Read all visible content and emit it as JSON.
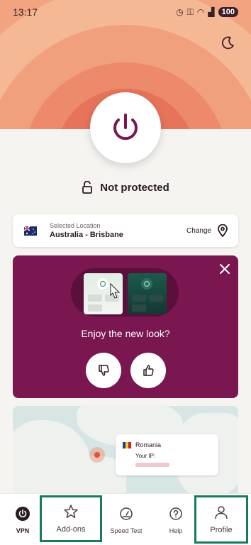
{
  "status_bar": {
    "time": "13:17",
    "battery": "100"
  },
  "status": {
    "label": "Not protected"
  },
  "location": {
    "caption": "Selected Location",
    "name": "Australia - Brisbane",
    "change_label": "Change"
  },
  "promo": {
    "title": "Enjoy the new look?"
  },
  "map": {
    "country": "Romania",
    "ip_caption": "Your IP:"
  },
  "nav": {
    "items": [
      {
        "label": "VPN",
        "icon": "power-icon"
      },
      {
        "label": "Add-ons",
        "icon": "star-icon"
      },
      {
        "label": "Speed Test",
        "icon": "speedometer-icon"
      },
      {
        "label": "Help",
        "icon": "help-icon"
      },
      {
        "label": "Profile",
        "icon": "person-icon"
      }
    ]
  },
  "colors": {
    "brand": "#7a1750",
    "highlight": "#167a5c",
    "accent_orange": "#e6745a"
  }
}
